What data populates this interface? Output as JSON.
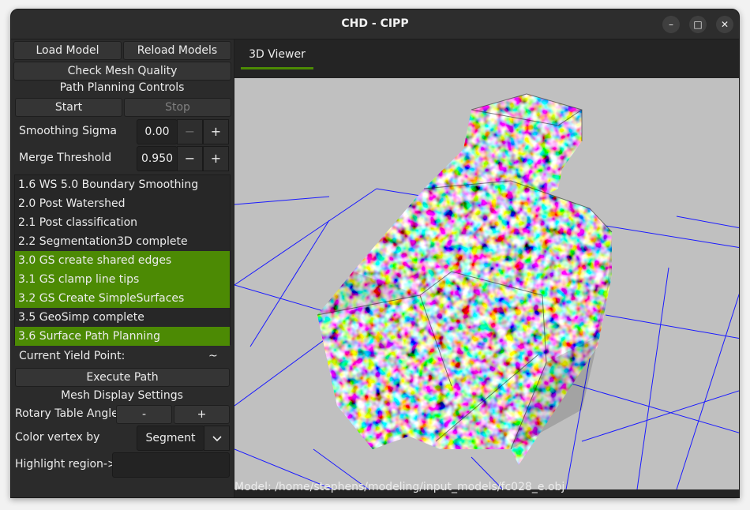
{
  "window": {
    "title": "CHD - CIPP",
    "minimize_glyph": "–",
    "maximize_glyph": "□",
    "close_glyph": "✕"
  },
  "sidebar": {
    "load_model": "Load Model",
    "reload_models": "Reload Models",
    "check_mesh": "Check Mesh Quality",
    "path_planning_title": "Path Planning Controls",
    "start": "Start",
    "stop": "Stop",
    "smoothing_sigma_label": "Smoothing Sigma",
    "smoothing_sigma_value": "0.00",
    "merge_threshold_label": "Merge Threshold",
    "merge_threshold_value": "0.950",
    "minus": "−",
    "plus": "+",
    "stages": [
      {
        "label": "1.6 WS 5.0 Boundary Smoothing",
        "highlighted": false
      },
      {
        "label": "2.0 Post Watershed",
        "highlighted": false
      },
      {
        "label": "2.1 Post classification",
        "highlighted": false
      },
      {
        "label": "2.2 Segmentation3D complete",
        "highlighted": false
      },
      {
        "label": "3.0 GS create shared edges",
        "highlighted": true
      },
      {
        "label": "3.1 GS clamp line tips",
        "highlighted": true
      },
      {
        "label": "3.2 GS Create SimpleSurfaces",
        "highlighted": true
      },
      {
        "label": "3.5 GeoSimp complete",
        "highlighted": false
      },
      {
        "label": "3.6 Surface Path Planning",
        "highlighted": true
      }
    ],
    "yield_point_label": "Current Yield Point:",
    "yield_point_value": "~",
    "execute_path": "Execute Path",
    "mesh_display_title": "Mesh Display Settings",
    "rotary_label": "Rotary Table Angle",
    "rotary_minus": "-",
    "rotary_plus": "+",
    "color_vertex_label": "Color vertex by",
    "color_vertex_value": "Segment",
    "highlight_label": "Highlight region->",
    "highlight_value": ""
  },
  "viewer": {
    "tab_label": "3D Viewer",
    "status": "Model: /home/stephens/modeling/input_models/fc028_e.obj"
  },
  "colors": {
    "accent": "#4c8a04",
    "background": "#2b2b2b",
    "viewport": "#c0c0c0",
    "grid": "#1a1aff"
  }
}
